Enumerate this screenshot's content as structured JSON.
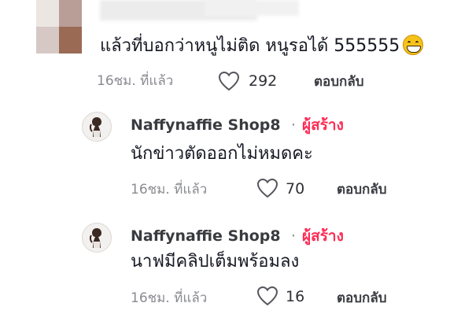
{
  "main_comment": {
    "text": "แล้วที่บอกว่าหนูไม่ติด หนูรอได้ 555555",
    "emoji": "grinning-face-with-big-eyes",
    "time": "16ชม. ที่แล้ว",
    "likes": "292",
    "reply_label": "ตอบกลับ"
  },
  "replies": [
    {
      "username": "Naffynaffie Shop8",
      "separator": "·",
      "badge": "ผู้สร้าง",
      "text": "นักข่าวตัดออกไม่หมดคะ",
      "time": "16ชม. ที่แล้ว",
      "likes": "70",
      "reply_label": "ตอบกลับ"
    },
    {
      "username": "Naffynaffie Shop8",
      "separator": "·",
      "badge": "ผู้สร้าง",
      "text": "นาฟมีคลิปเต็มพร้อมลง",
      "time": "16ชม. ที่แล้ว",
      "likes": "16",
      "reply_label": "ตอบกลับ"
    }
  ],
  "colors": {
    "creator_badge": "#fe2c55",
    "meta_text": "#8a8b91",
    "primary_text": "#161823"
  }
}
